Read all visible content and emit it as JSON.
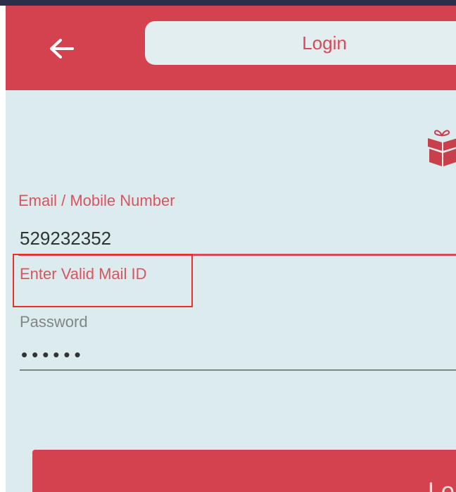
{
  "colors": {
    "brand": "#d4414f",
    "background": "#dcecee",
    "error_outline": "#ee2d2d",
    "label": "#d8545f"
  },
  "header": {
    "back_icon": "arrow-left-icon",
    "title": "Login",
    "gift_icon": "gift-icon"
  },
  "form": {
    "email_label": "Email / Mobile Number",
    "email_value": "529232352",
    "error_message": "Enter Valid Mail ID",
    "password_label": "Password",
    "password_value": "••••••"
  },
  "actions": {
    "login_button_label": "Lo"
  }
}
